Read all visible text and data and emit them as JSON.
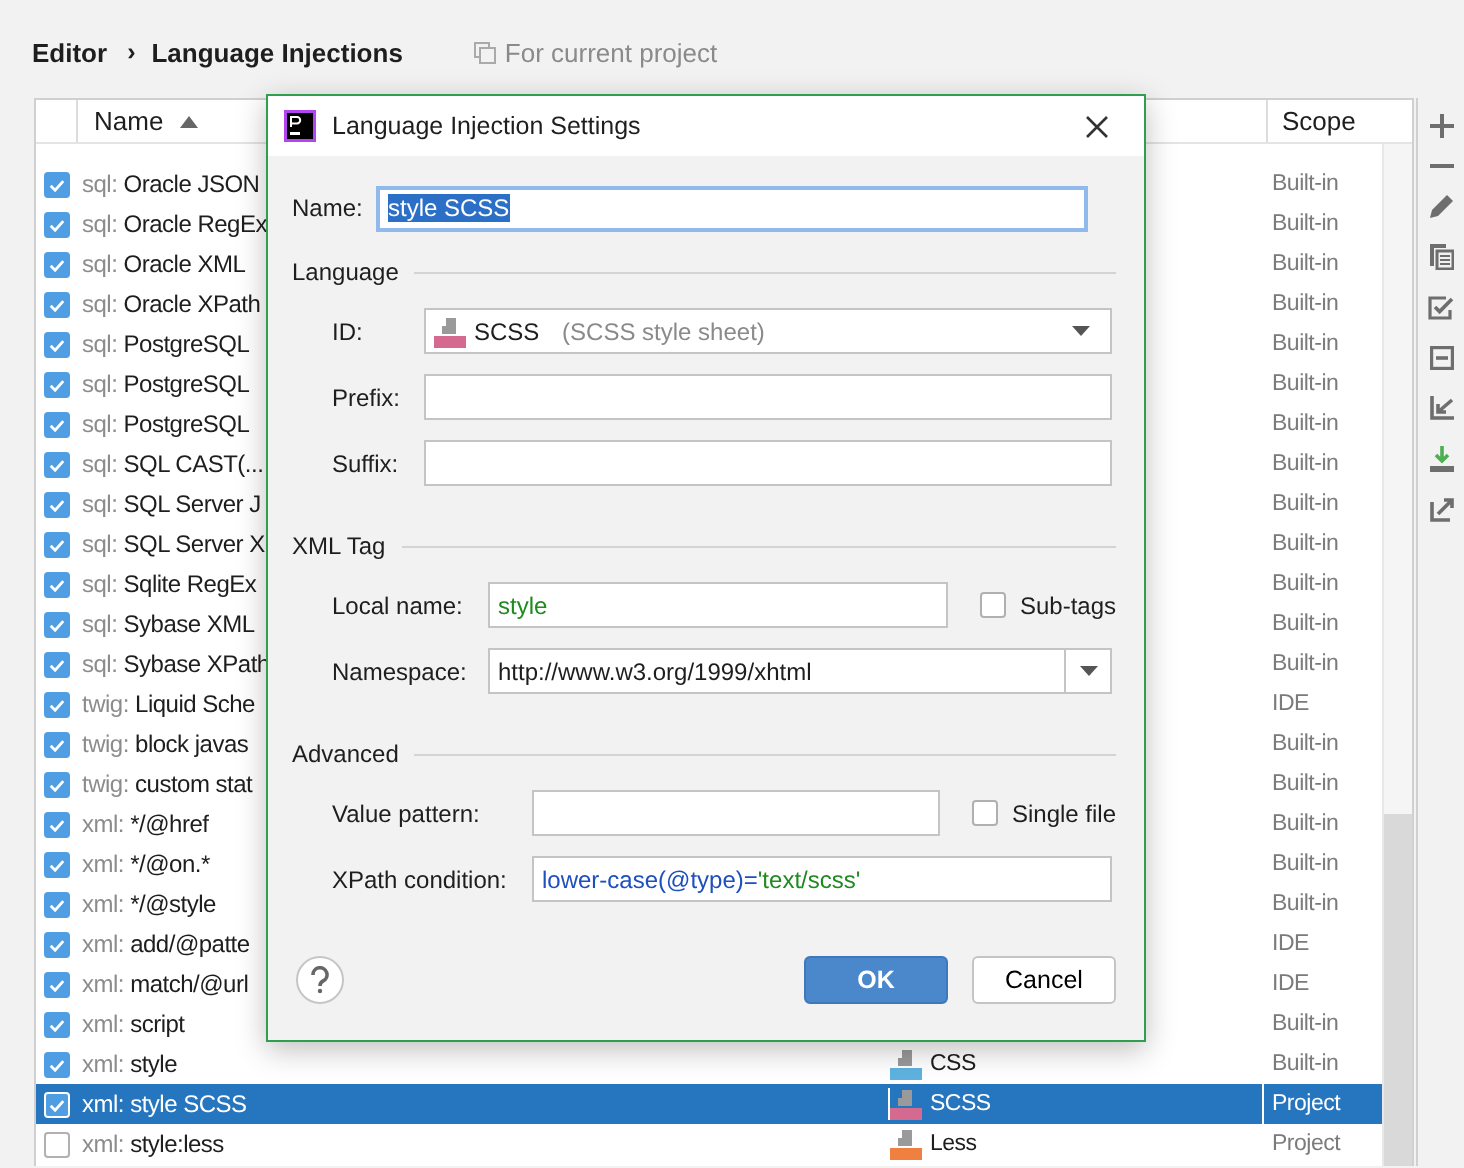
{
  "breadcrumb": {
    "items": [
      "Editor",
      "Language Injections"
    ],
    "separator": "›",
    "scope_note": "For current project"
  },
  "table": {
    "columns": [
      "Name",
      "Scope"
    ],
    "sort_ascending": true,
    "rows": [
      {
        "prefix": "sql:",
        "name": "Oracle JSON",
        "scope": "Built-in",
        "checked": true,
        "selected": false
      },
      {
        "prefix": "sql:",
        "name": "Oracle RegEx",
        "scope": "Built-in",
        "checked": true,
        "selected": false
      },
      {
        "prefix": "sql:",
        "name": "Oracle XML",
        "scope": "Built-in",
        "checked": true,
        "selected": false
      },
      {
        "prefix": "sql:",
        "name": "Oracle XPath",
        "scope": "Built-in",
        "checked": true,
        "selected": false
      },
      {
        "prefix": "sql:",
        "name": "PostgreSQL",
        "scope": "Built-in",
        "checked": true,
        "selected": false
      },
      {
        "prefix": "sql:",
        "name": "PostgreSQL",
        "scope": "Built-in",
        "checked": true,
        "selected": false
      },
      {
        "prefix": "sql:",
        "name": "PostgreSQL",
        "scope": "Built-in",
        "checked": true,
        "selected": false
      },
      {
        "prefix": "sql:",
        "name": "SQL CAST(...",
        "scope": "Built-in",
        "checked": true,
        "selected": false
      },
      {
        "prefix": "sql:",
        "name": "SQL Server J",
        "scope": "Built-in",
        "checked": true,
        "selected": false
      },
      {
        "prefix": "sql:",
        "name": "SQL Server X",
        "scope": "Built-in",
        "checked": true,
        "selected": false
      },
      {
        "prefix": "sql:",
        "name": "Sqlite RegEx",
        "scope": "Built-in",
        "checked": true,
        "selected": false
      },
      {
        "prefix": "sql:",
        "name": "Sybase XML",
        "scope": "Built-in",
        "checked": true,
        "selected": false
      },
      {
        "prefix": "sql:",
        "name": "Sybase XPath",
        "scope": "Built-in",
        "checked": true,
        "selected": false
      },
      {
        "prefix": "twig:",
        "name": "Liquid Sche",
        "scope": "IDE",
        "checked": true,
        "selected": false
      },
      {
        "prefix": "twig:",
        "name": "block javas",
        "scope": "Built-in",
        "checked": true,
        "selected": false
      },
      {
        "prefix": "twig:",
        "name": "custom stat",
        "scope": "Built-in",
        "checked": true,
        "selected": false
      },
      {
        "prefix": "xml:",
        "name": "*/@href",
        "scope": "Built-in",
        "checked": true,
        "selected": false
      },
      {
        "prefix": "xml:",
        "name": "*/@on.*",
        "scope": "Built-in",
        "checked": true,
        "selected": false
      },
      {
        "prefix": "xml:",
        "name": "*/@style",
        "scope": "Built-in",
        "checked": true,
        "selected": false
      },
      {
        "prefix": "xml:",
        "name": "add/@patte",
        "scope": "IDE",
        "checked": true,
        "selected": false
      },
      {
        "prefix": "xml:",
        "name": "match/@url",
        "scope": "IDE",
        "checked": true,
        "selected": false
      },
      {
        "prefix": "xml:",
        "name": "script",
        "scope": "Built-in",
        "checked": true,
        "selected": false
      },
      {
        "prefix": "xml:",
        "name": "style",
        "language": {
          "name": "CSS",
          "kind": "css"
        },
        "scope": "Built-in",
        "checked": true,
        "selected": false
      },
      {
        "prefix": "xml:",
        "name": "style SCSS",
        "language": {
          "name": "SCSS",
          "kind": "sass"
        },
        "scope": "Project",
        "checked": true,
        "selected": true
      },
      {
        "prefix": "xml:",
        "name": "style:less",
        "language": {
          "name": "Less",
          "kind": "less"
        },
        "scope": "Project",
        "checked": false,
        "selected": false
      }
    ]
  },
  "dialog": {
    "title": "Language Injection Settings",
    "name": {
      "label": "Name:",
      "value": "style SCSS"
    },
    "language": {
      "heading": "Language",
      "id_label": "ID:",
      "id_language": {
        "name": "SCSS",
        "kind": "sass"
      },
      "id_description": "(SCSS style sheet)",
      "prefix_label": "Prefix:",
      "suffix_label": "Suffix:"
    },
    "xml_tag": {
      "heading": "XML Tag",
      "local_name_label": "Local name:",
      "local_name": "style",
      "subtags_label": "Sub-tags",
      "subtags_checked": false,
      "namespace_label": "Namespace:",
      "namespace": "http://www.w3.org/1999/xhtml"
    },
    "advanced": {
      "heading": "Advanced",
      "value_pattern_label": "Value pattern:",
      "single_file_label": "Single file",
      "single_file_checked": false,
      "xpath_label": "XPath condition:",
      "xpath_parts": [
        {
          "text": "lower-case(@type)=",
          "kind": "function"
        },
        {
          "text": "'text/scss'",
          "kind": "string"
        }
      ]
    },
    "buttons": [
      {
        "label": "OK",
        "kind": "primary"
      },
      {
        "label": "Cancel",
        "kind": "secondary"
      }
    ]
  }
}
